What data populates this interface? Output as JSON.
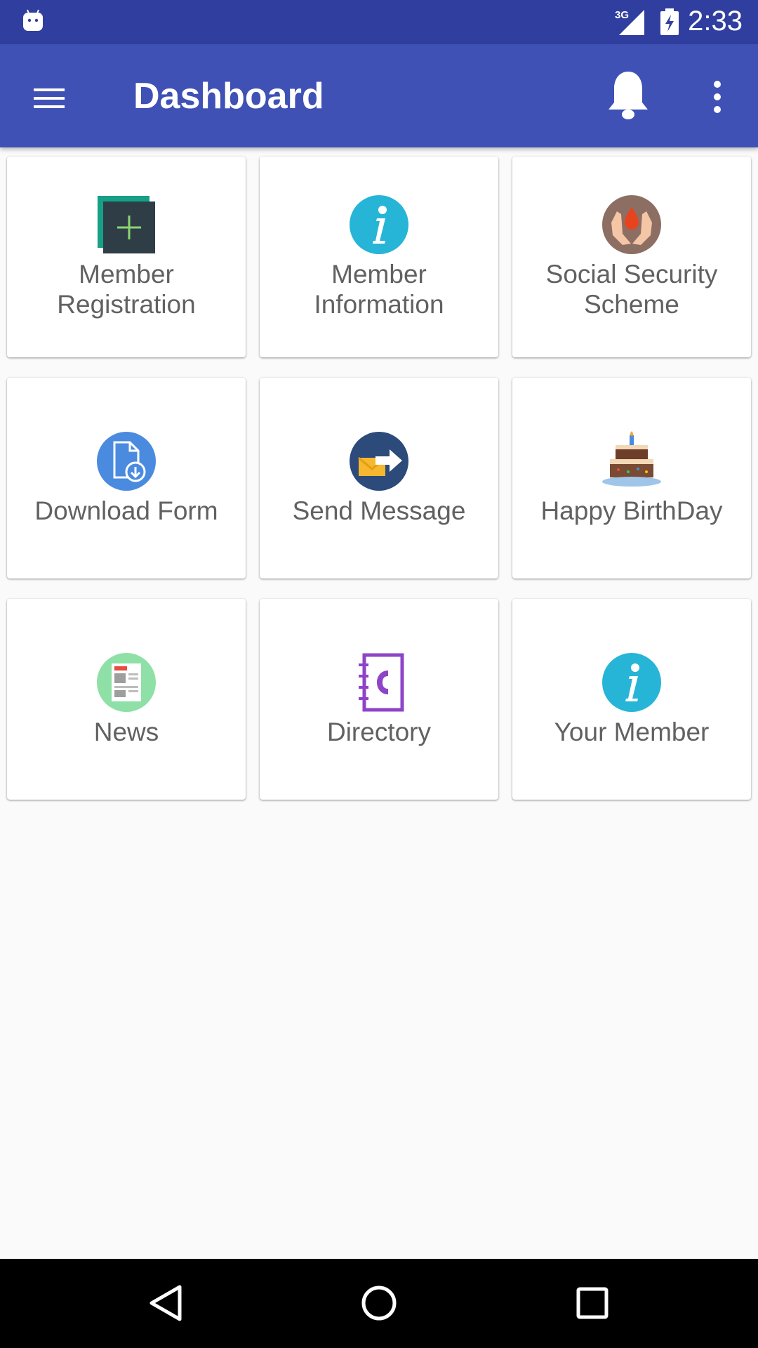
{
  "status_bar": {
    "time": "2:33",
    "network": "3G"
  },
  "app_bar": {
    "title": "Dashboard"
  },
  "tiles": [
    {
      "label": "Member Registration",
      "icon": "add-icon"
    },
    {
      "label": "Member Information",
      "icon": "info-icon"
    },
    {
      "label": "Social Security Scheme",
      "icon": "blood-donation-icon"
    },
    {
      "label": "Download Form",
      "icon": "download-file-icon"
    },
    {
      "label": "Send Message",
      "icon": "send-mail-icon"
    },
    {
      "label": "Happy BirthDay",
      "icon": "birthday-cake-icon"
    },
    {
      "label": "News",
      "icon": "newspaper-icon"
    },
    {
      "label": "Directory",
      "icon": "phone-book-icon"
    },
    {
      "label": "Your Member",
      "icon": "info-icon"
    }
  ],
  "colors": {
    "status_bar": "#303f9f",
    "app_bar": "#3f51b5",
    "background": "#fafafa"
  }
}
